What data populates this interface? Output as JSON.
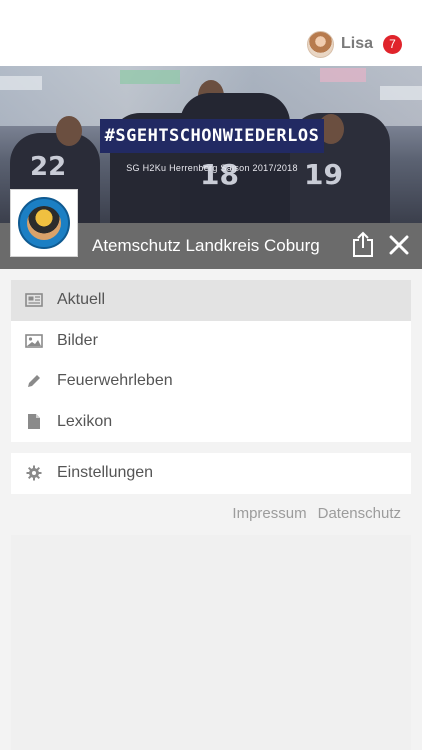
{
  "user": {
    "name": "Lisa",
    "notifications": "7"
  },
  "banner": {
    "hashtag": "#SGEHTSCHONWIEDERLOS",
    "subline": "SG H2Ku Herrenberg Saison 2017/2018",
    "jersey_numbers": [
      "22",
      "18",
      "19"
    ]
  },
  "organization": {
    "title": "Atemschutz Landkreis Coburg"
  },
  "menu": {
    "items": [
      {
        "label": "Aktuell",
        "icon": "newspaper-icon",
        "active": true
      },
      {
        "label": "Bilder",
        "icon": "image-icon",
        "active": false
      },
      {
        "label": "Feuerwehrleben",
        "icon": "pencil-icon",
        "active": false
      },
      {
        "label": "Lexikon",
        "icon": "document-icon",
        "active": false
      }
    ],
    "settings": {
      "label": "Einstellungen",
      "icon": "gear-icon"
    }
  },
  "footer": {
    "impressum": "Impressum",
    "datenschutz": "Datenschutz"
  },
  "colors": {
    "badge": "#e0232b",
    "titlebar": "#6b6b6b",
    "hashtag_bg": "#222a63"
  }
}
